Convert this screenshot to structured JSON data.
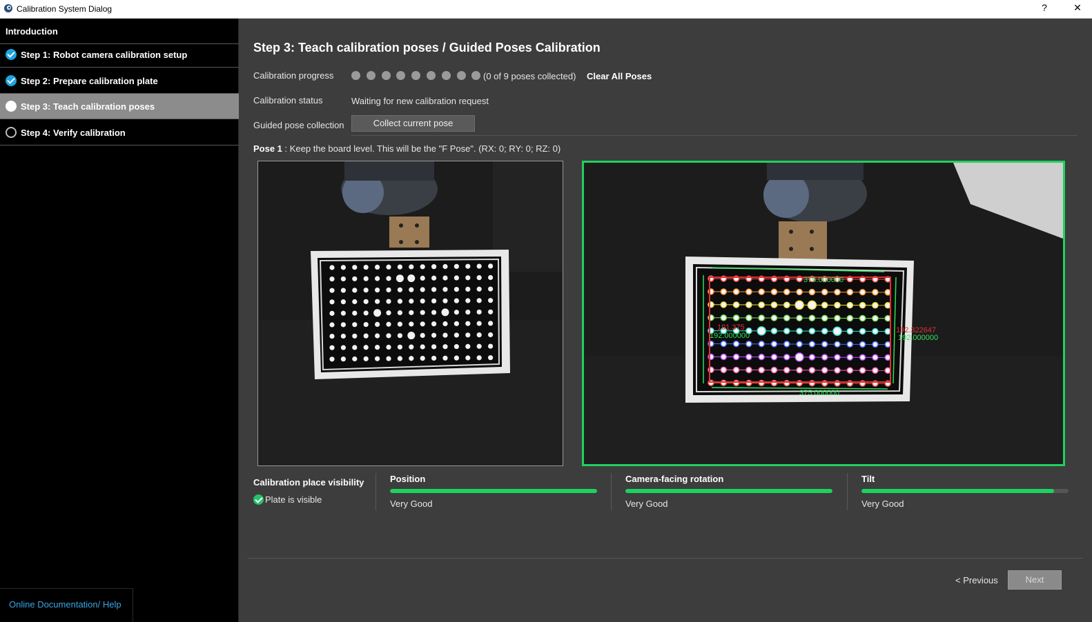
{
  "window": {
    "title": "Calibration System Dialog",
    "help_label": "?",
    "close_label": "✕"
  },
  "sidebar": {
    "intro_label": "Introduction",
    "steps": [
      {
        "label": "Step 1: Robot camera calibration setup",
        "state": "done",
        "icon": "checkmark-icon"
      },
      {
        "label": "Step 2: Prepare calibration plate",
        "state": "done",
        "icon": "checkmark-icon"
      },
      {
        "label": "Step 3: Teach calibration poses",
        "state": "current",
        "icon": "filled-circle-icon"
      },
      {
        "label": "Step 4: Verify calibration",
        "state": "todo",
        "icon": "empty-circle-icon"
      }
    ],
    "help_link": "Online Documentation/ Help"
  },
  "main": {
    "title": "Step 3: Teach calibration poses / Guided Poses Calibration",
    "progress_label": "Calibration progress",
    "progress_collected": 0,
    "progress_total": 9,
    "progress_text": "(0 of 9 poses collected)",
    "clear_label": "Clear All Poses",
    "status_label": "Calibration status",
    "status_value": "Waiting for new calibration request",
    "guided_label": "Guided pose collection",
    "collect_label": "Collect current pose",
    "pose_title": "Pose 1",
    "pose_text": " : Keep the board level. This will be the \"F Pose\". (RX: 0; RY: 0; RZ: 0)"
  },
  "quality": {
    "visibility_title": "Calibration place visibility",
    "visibility_text": "Plate is visible",
    "metrics": [
      {
        "title": "Position",
        "value": "Very Good",
        "level": 1.0
      },
      {
        "title": "Camera-facing rotation",
        "value": "Very Good",
        "level": 1.0
      },
      {
        "title": "Tilt",
        "value": "Very Good",
        "level": 0.93
      }
    ]
  },
  "footer": {
    "prev_label": "< Previous",
    "next_label": "Next"
  },
  "overlay_labels": {
    "top": "375.000000",
    "bottom": "375.000000",
    "left_red": "191.375",
    "left_green": "192.000000",
    "right_red": "192.322647",
    "right_green": "192.000000"
  },
  "colors": {
    "accent_green": "#1fd160",
    "check_blue": "#1fa3e0",
    "link_blue": "#3aa6e8"
  }
}
